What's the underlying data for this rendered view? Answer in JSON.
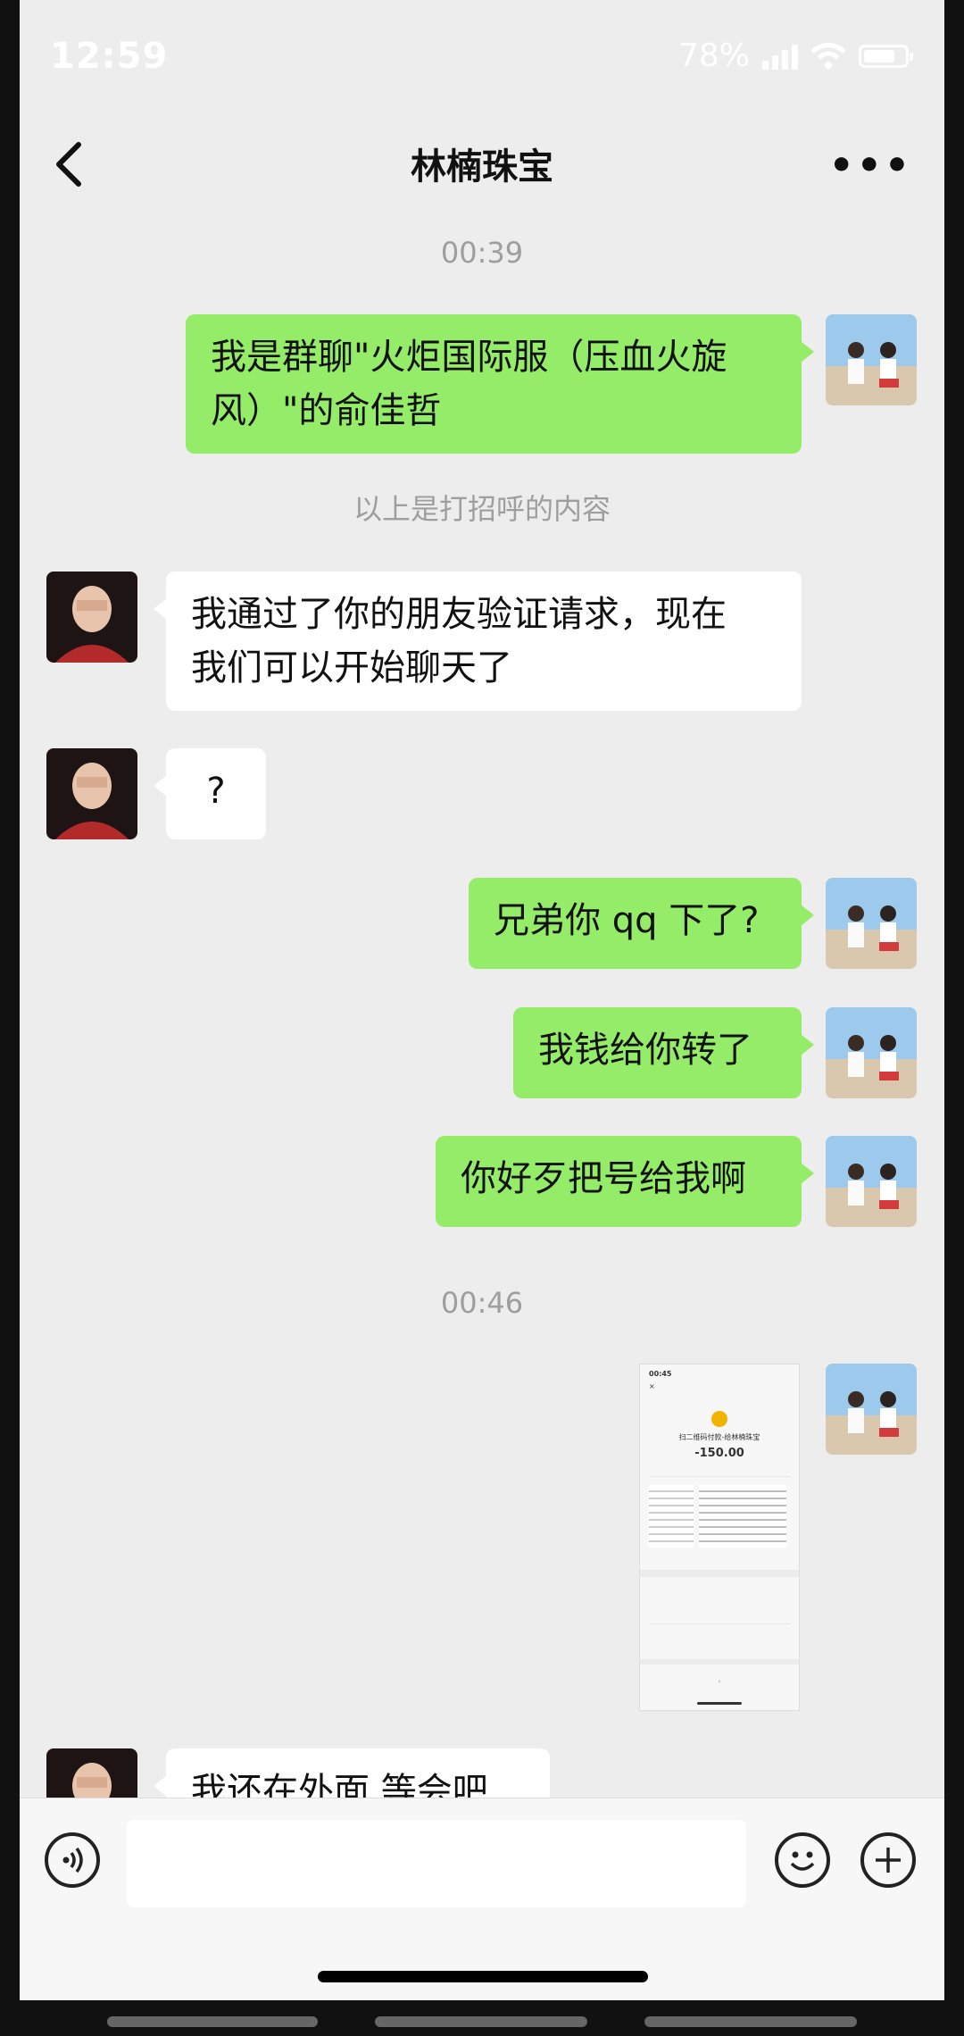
{
  "status": {
    "time": "12:59",
    "battery": "78%",
    "battery_level": 0.78
  },
  "nav": {
    "title": "林楠珠宝"
  },
  "messages": {
    "ts1": "00:39",
    "m1_line1": "我是群聊\"火炬国际服（压血火旋",
    "m1_line2": "风）\"的俞佳哲",
    "notice": "以上是打招呼的内容",
    "m2_line1": "我通过了你的朋友验证请求，现在",
    "m2_line2": "我们可以开始聊天了",
    "m3": "?",
    "m4": "兄弟你 qq 下了?",
    "m5": "我钱给你转了",
    "m6": "你好歹把号给我啊",
    "ts2": "00:46",
    "m7": "我还在外面 等会吧"
  },
  "shot": {
    "time": "00:45",
    "payee": "扫二维码付款-给林楠珠宝",
    "amount": "-150.00"
  },
  "icons": {
    "back": "chevron-left-icon",
    "more": "more-icon",
    "voice": "voice-icon",
    "emoji": "emoji-icon",
    "plus": "plus-icon"
  }
}
